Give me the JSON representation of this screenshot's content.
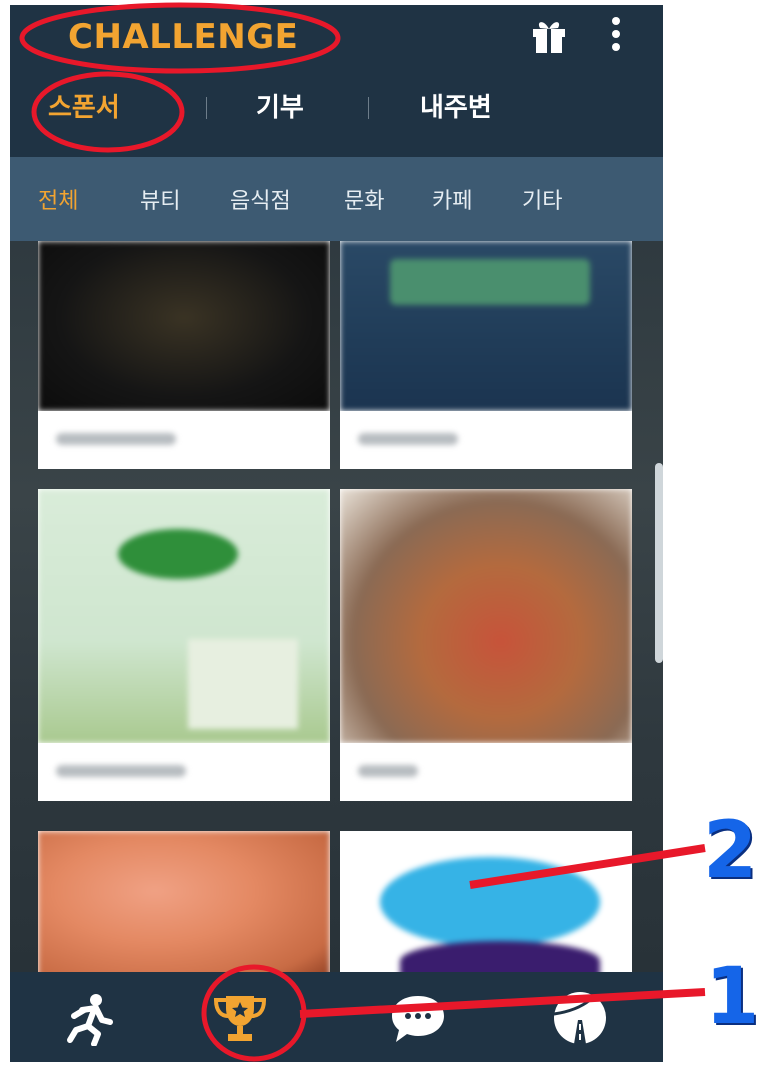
{
  "header": {
    "title": "CHALLENGE",
    "tabs": [
      {
        "label": "스폰서",
        "active": true
      },
      {
        "label": "기부",
        "active": false
      },
      {
        "label": "내주변",
        "active": false
      }
    ],
    "icons": [
      "gift-icon",
      "more-vertical-icon"
    ]
  },
  "categories": [
    {
      "label": "전체",
      "active": true
    },
    {
      "label": "뷰티",
      "active": false
    },
    {
      "label": "음식점",
      "active": false
    },
    {
      "label": "문화",
      "active": false
    },
    {
      "label": "카페",
      "active": false
    },
    {
      "label": "기타",
      "active": false
    }
  ],
  "bottom_nav": [
    {
      "icon": "running-person-icon",
      "active": false
    },
    {
      "icon": "trophy-icon",
      "active": true
    },
    {
      "icon": "chat-bubble-icon",
      "active": false
    },
    {
      "icon": "road-icon",
      "active": false
    }
  ],
  "annotations": {
    "label_1": "1",
    "label_2": "2"
  },
  "colors": {
    "accent": "#f2a431",
    "header_bg": "#1f3344",
    "category_bg": "#3d5a72",
    "highlight_red": "#e8182a",
    "annotation_blue": "#1565e8"
  }
}
